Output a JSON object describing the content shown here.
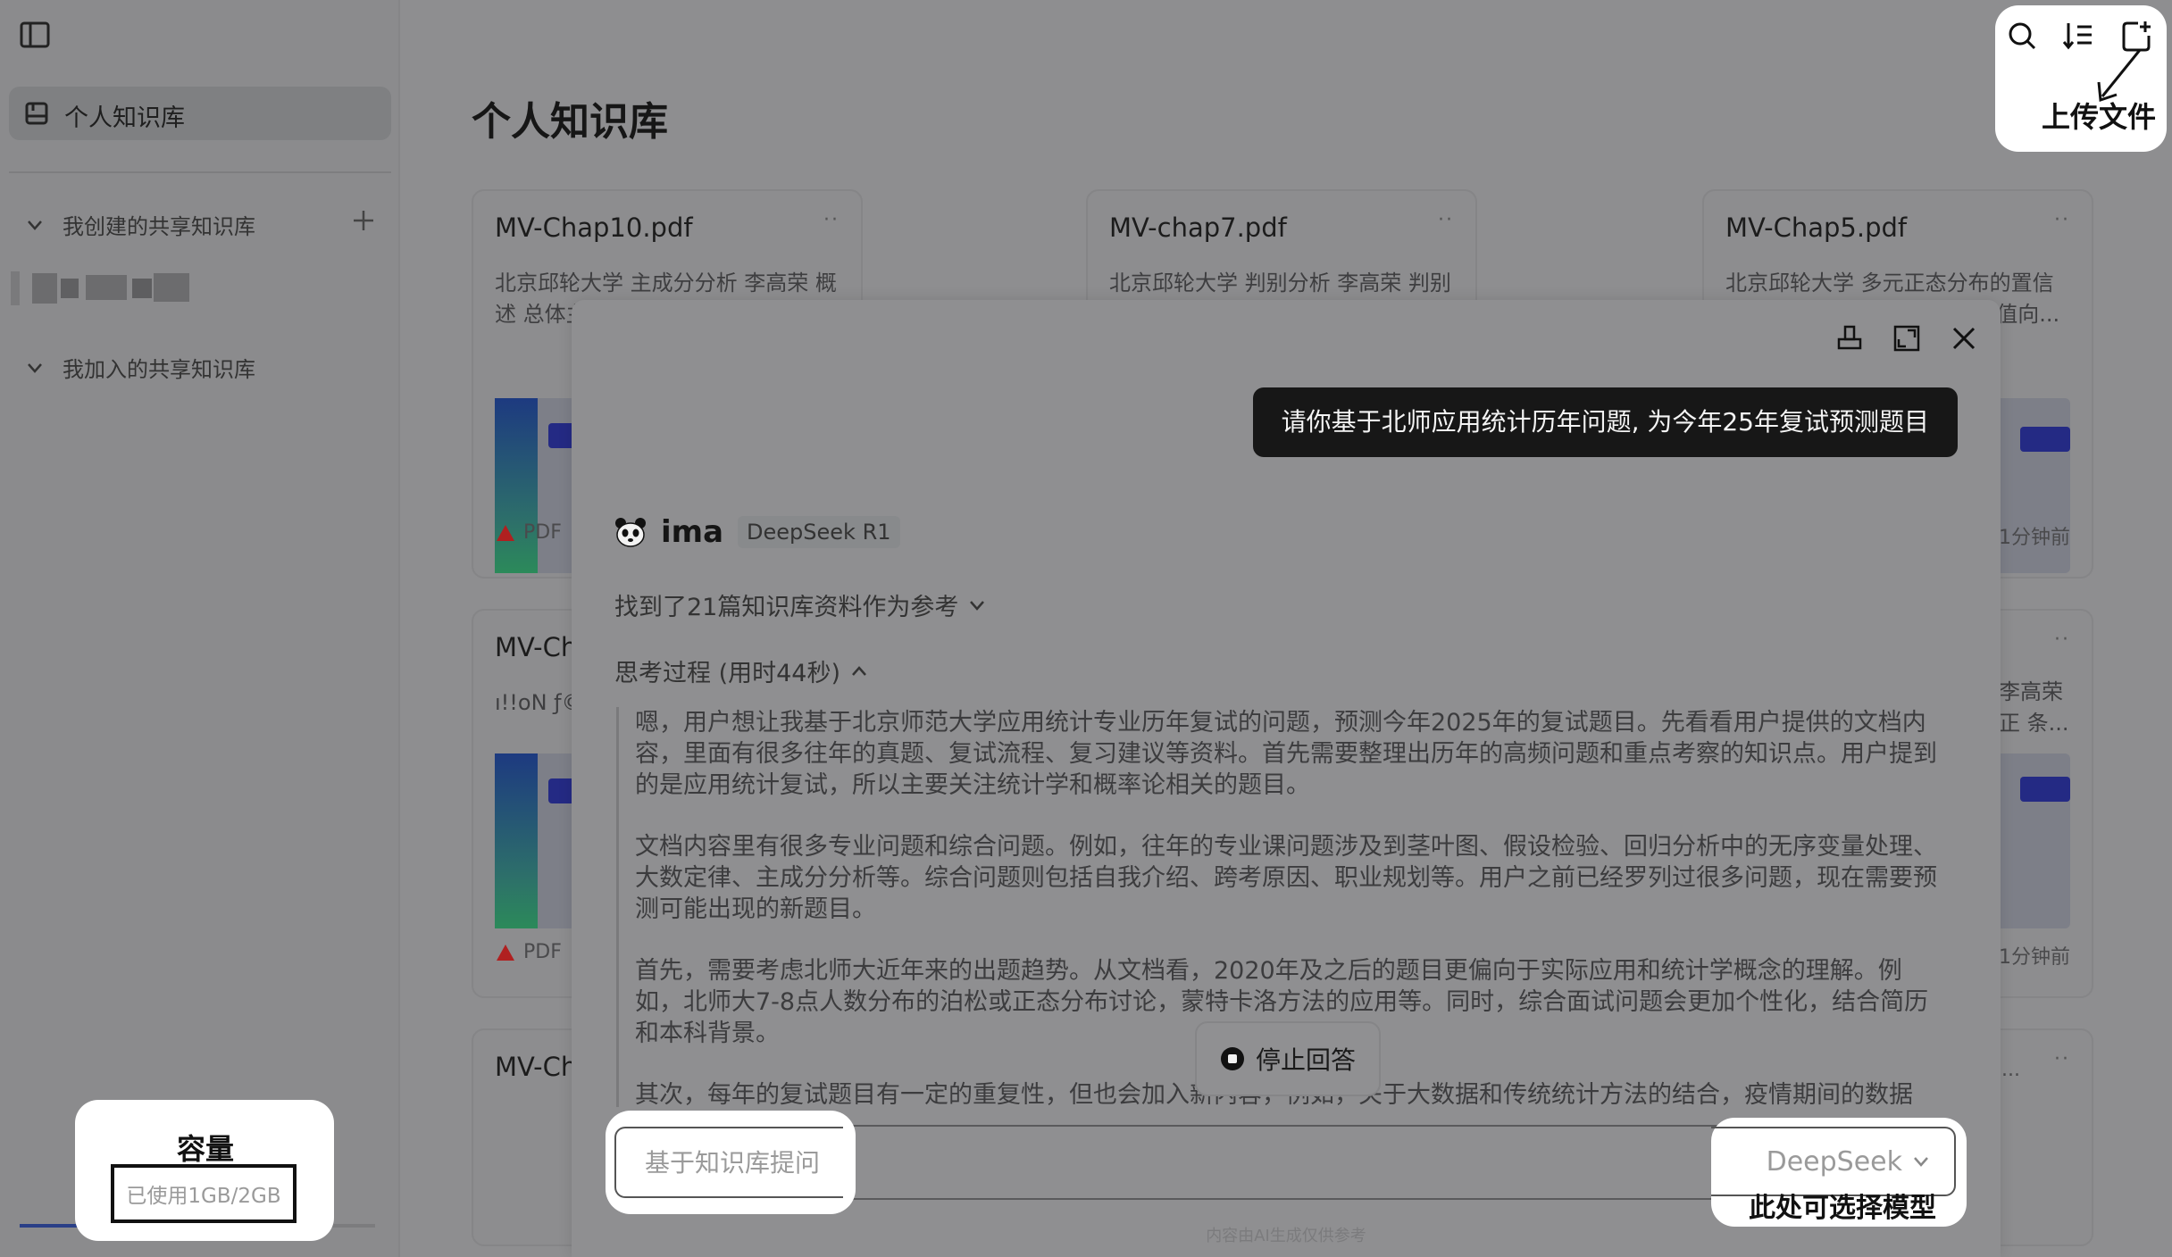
{
  "sidebar": {
    "personal_label": "个人知识库",
    "created_section": "我创建的共享知识库",
    "joined_section": "我加入的共享知识库"
  },
  "main": {
    "title": "个人知识库",
    "cards": [
      {
        "title": "MV-Chap10.pdf",
        "desc": "北京邱轮大学 主成分分析 李高荣 概述 总体主成分分析 主成分的推导",
        "meta": "PDF",
        "time": ""
      },
      {
        "title": "MV-chap7.pdf",
        "desc": "北京邱轮大学 判别分析 李高荣 判别分析简介判别分析的准则 概率分",
        "meta": "",
        "time": ""
      },
      {
        "title": "MV-Chap5.pdf",
        "desc": "北京邱轮大学 多元正态分布的置信域和假设检验 李高荣 总体均值向...",
        "meta": "",
        "time": "1分钟前"
      },
      {
        "title": "MV-Ch",
        "desc": "ı!!oN ƒ© otelling",
        "meta": "PDF",
        "time": ""
      },
      {
        "title": "",
        "desc": "李高荣 正 条...",
        "meta": "",
        "time": "1分钟前"
      },
      {
        "title": "MV-Ch",
        "desc": "",
        "meta": "",
        "time": "..."
      }
    ]
  },
  "toolbar": {
    "upload_note": "上传文件"
  },
  "chat": {
    "user_message": "请你基于北师应用统计历年问题, 为今年25年复试预测题目",
    "bot_name": "ima",
    "model_tag": "DeepSeek R1",
    "refs_label": "找到了21篇知识库资料作为参考",
    "think_label": "思考过程 (用时44秒)",
    "think_paragraphs": [
      "嗯，用户想让我基于北京师范大学应用统计专业历年复试的问题，预测今年2025年的复试题目。先看看用户提供的文档内容，里面有很多往年的真题、复试流程、复习建议等资料。首先需要整理出历年的高频问题和重点考察的知识点。用户提到的是应用统计复试，所以主要关注统计学和概率论相关的题目。",
      "文档内容里有很多专业问题和综合问题。例如，往年的专业课问题涉及到茎叶图、假设检验、回归分析中的无序变量处理、大数定律、主成分分析等。综合问题则包括自我介绍、跨考原因、职业规划等。用户之前已经罗列过很多问题，现在需要预测可能出现的新题目。",
      "首先，需要考虑北师大近年来的出题趋势。从文档看，2020年及之后的题目更偏向于实际应用和统计学概念的理解。例如，北师大7-8点人数分布的泊松或正态分布讨论，蒙特卡洛方法的应用等。同时，综合面试问题会更加个性化，结合简历和本科背景。",
      "其次，每年的复试题目有一定的重复性，但也会加入新内容，例如，关于大数据和传统统计方法的结合，疫情期间的数据"
    ],
    "stop_label": "停止回答",
    "input_placeholder": "基于知识库提问",
    "model_select": "DeepSeek",
    "model_note": "此处可选择模型",
    "disclaimer": "内容由AI生成仅供参考"
  },
  "storage": {
    "title": "容量",
    "usage": "已使用1GB/2GB",
    "used_fraction": 0.5
  }
}
